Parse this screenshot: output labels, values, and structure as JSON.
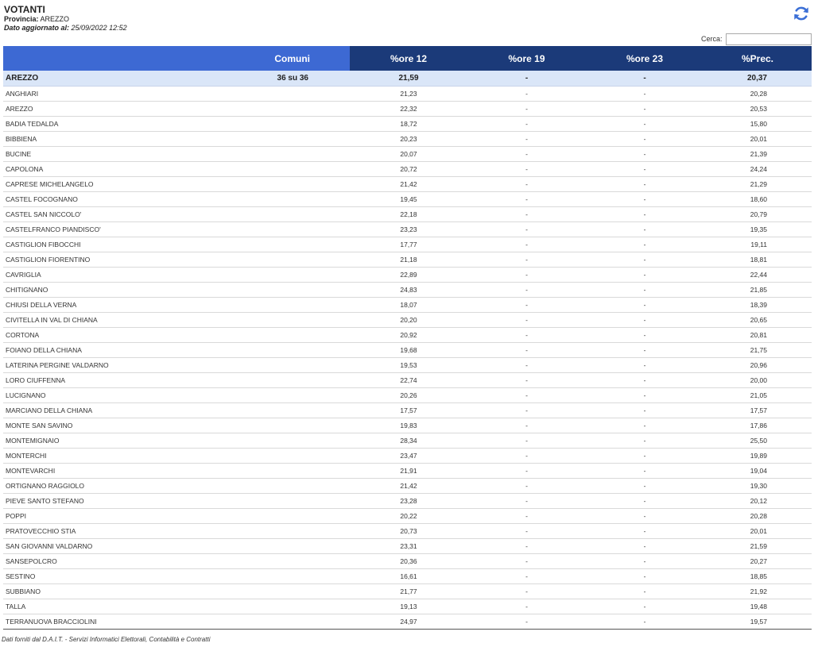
{
  "header": {
    "title": "VOTANTI",
    "provincia_label": "Provincia:",
    "provincia_value": "AREZZO",
    "updated_label": "Dato aggiornato al:",
    "updated_value": "25/09/2022 12:52"
  },
  "search": {
    "label": "Cerca:",
    "value": ""
  },
  "refresh_icon": "refresh-icon",
  "columns": [
    "",
    "Comuni",
    "%ore 12",
    "%ore 19",
    "%ore 23",
    "%Prec."
  ],
  "total": {
    "name": "AREZZO",
    "comuni": "36 su 36",
    "ore12": "21,59",
    "ore19": "-",
    "ore23": "-",
    "prec": "20,37"
  },
  "rows": [
    {
      "name": "ANGHIARI",
      "ore12": "21,23",
      "ore19": "-",
      "ore23": "-",
      "prec": "20,28"
    },
    {
      "name": "AREZZO",
      "ore12": "22,32",
      "ore19": "-",
      "ore23": "-",
      "prec": "20,53"
    },
    {
      "name": "BADIA TEDALDA",
      "ore12": "18,72",
      "ore19": "-",
      "ore23": "-",
      "prec": "15,80"
    },
    {
      "name": "BIBBIENA",
      "ore12": "20,23",
      "ore19": "-",
      "ore23": "-",
      "prec": "20,01"
    },
    {
      "name": "BUCINE",
      "ore12": "20,07",
      "ore19": "-",
      "ore23": "-",
      "prec": "21,39"
    },
    {
      "name": "CAPOLONA",
      "ore12": "20,72",
      "ore19": "-",
      "ore23": "-",
      "prec": "24,24"
    },
    {
      "name": "CAPRESE MICHELANGELO",
      "ore12": "21,42",
      "ore19": "-",
      "ore23": "-",
      "prec": "21,29"
    },
    {
      "name": "CASTEL FOCOGNANO",
      "ore12": "19,45",
      "ore19": "-",
      "ore23": "-",
      "prec": "18,60"
    },
    {
      "name": "CASTEL SAN NICCOLO'",
      "ore12": "22,18",
      "ore19": "-",
      "ore23": "-",
      "prec": "20,79"
    },
    {
      "name": "CASTELFRANCO PIANDISCO'",
      "ore12": "23,23",
      "ore19": "-",
      "ore23": "-",
      "prec": "19,35"
    },
    {
      "name": "CASTIGLION FIBOCCHI",
      "ore12": "17,77",
      "ore19": "-",
      "ore23": "-",
      "prec": "19,11"
    },
    {
      "name": "CASTIGLION FIORENTINO",
      "ore12": "21,18",
      "ore19": "-",
      "ore23": "-",
      "prec": "18,81"
    },
    {
      "name": "CAVRIGLIA",
      "ore12": "22,89",
      "ore19": "-",
      "ore23": "-",
      "prec": "22,44"
    },
    {
      "name": "CHITIGNANO",
      "ore12": "24,83",
      "ore19": "-",
      "ore23": "-",
      "prec": "21,85"
    },
    {
      "name": "CHIUSI DELLA VERNA",
      "ore12": "18,07",
      "ore19": "-",
      "ore23": "-",
      "prec": "18,39"
    },
    {
      "name": "CIVITELLA IN VAL DI CHIANA",
      "ore12": "20,20",
      "ore19": "-",
      "ore23": "-",
      "prec": "20,65"
    },
    {
      "name": "CORTONA",
      "ore12": "20,92",
      "ore19": "-",
      "ore23": "-",
      "prec": "20,81"
    },
    {
      "name": "FOIANO DELLA CHIANA",
      "ore12": "19,68",
      "ore19": "-",
      "ore23": "-",
      "prec": "21,75"
    },
    {
      "name": "LATERINA PERGINE VALDARNO",
      "ore12": "19,53",
      "ore19": "-",
      "ore23": "-",
      "prec": "20,96"
    },
    {
      "name": "LORO CIUFFENNA",
      "ore12": "22,74",
      "ore19": "-",
      "ore23": "-",
      "prec": "20,00"
    },
    {
      "name": "LUCIGNANO",
      "ore12": "20,26",
      "ore19": "-",
      "ore23": "-",
      "prec": "21,05"
    },
    {
      "name": "MARCIANO DELLA CHIANA",
      "ore12": "17,57",
      "ore19": "-",
      "ore23": "-",
      "prec": "17,57"
    },
    {
      "name": "MONTE SAN SAVINO",
      "ore12": "19,83",
      "ore19": "-",
      "ore23": "-",
      "prec": "17,86"
    },
    {
      "name": "MONTEMIGNAIO",
      "ore12": "28,34",
      "ore19": "-",
      "ore23": "-",
      "prec": "25,50"
    },
    {
      "name": "MONTERCHI",
      "ore12": "23,47",
      "ore19": "-",
      "ore23": "-",
      "prec": "19,89"
    },
    {
      "name": "MONTEVARCHI",
      "ore12": "21,91",
      "ore19": "-",
      "ore23": "-",
      "prec": "19,04"
    },
    {
      "name": "ORTIGNANO RAGGIOLO",
      "ore12": "21,42",
      "ore19": "-",
      "ore23": "-",
      "prec": "19,30"
    },
    {
      "name": "PIEVE SANTO STEFANO",
      "ore12": "23,28",
      "ore19": "-",
      "ore23": "-",
      "prec": "20,12"
    },
    {
      "name": "POPPI",
      "ore12": "20,22",
      "ore19": "-",
      "ore23": "-",
      "prec": "20,28"
    },
    {
      "name": "PRATOVECCHIO STIA",
      "ore12": "20,73",
      "ore19": "-",
      "ore23": "-",
      "prec": "20,01"
    },
    {
      "name": "SAN GIOVANNI VALDARNO",
      "ore12": "23,31",
      "ore19": "-",
      "ore23": "-",
      "prec": "21,59"
    },
    {
      "name": "SANSEPOLCRO",
      "ore12": "20,36",
      "ore19": "-",
      "ore23": "-",
      "prec": "20,27"
    },
    {
      "name": "SESTINO",
      "ore12": "16,61",
      "ore19": "-",
      "ore23": "-",
      "prec": "18,85"
    },
    {
      "name": "SUBBIANO",
      "ore12": "21,77",
      "ore19": "-",
      "ore23": "-",
      "prec": "21,92"
    },
    {
      "name": "TALLA",
      "ore12": "19,13",
      "ore19": "-",
      "ore23": "-",
      "prec": "19,48"
    },
    {
      "name": "TERRANUOVA BRACCIOLINI",
      "ore12": "24,97",
      "ore19": "-",
      "ore23": "-",
      "prec": "19,57"
    }
  ],
  "footer": "Dati forniti dal D.A.I.T. - Servizi Informatici Elettorali, Contabilità e Contratti",
  "colors": {
    "header_light": "#3d69d3",
    "header_dark": "#1b3a79",
    "total_row": "#dae6f8",
    "refresh_icon": "#3b6fd6"
  }
}
